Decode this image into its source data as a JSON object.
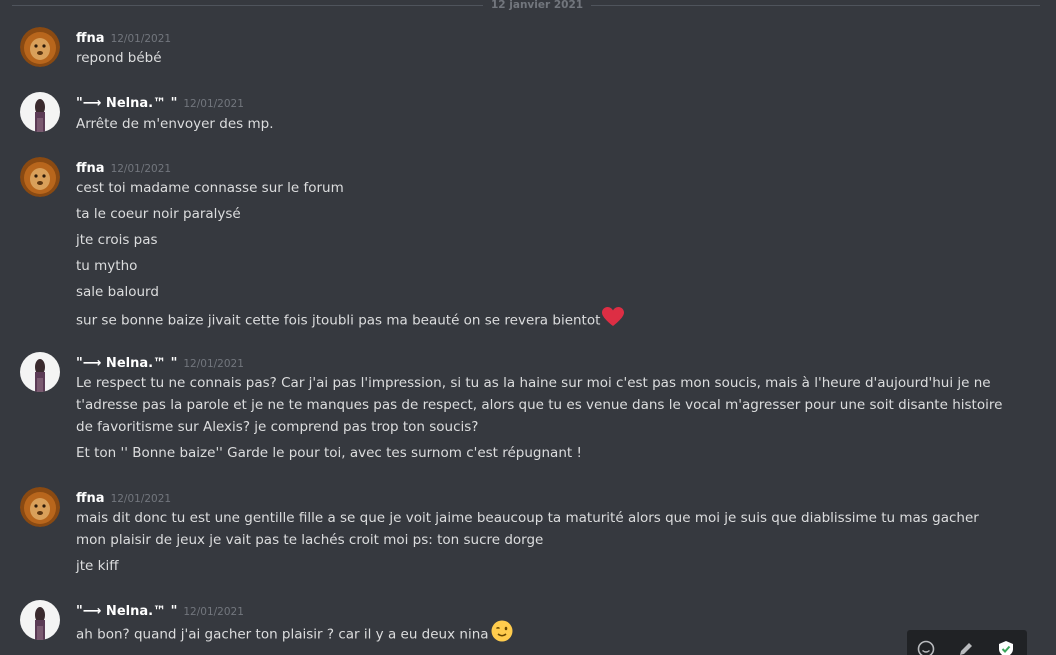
{
  "date_divider": "12 janvier 2021",
  "users": {
    "ffna": "ffna",
    "nelna": "\"⟶ Nelna.™ \""
  },
  "messages": [
    {
      "author": "ffna",
      "timestamp": "12/01/2021",
      "lines": [
        "repond bébé"
      ]
    },
    {
      "author": "\"⟶ Nelna.™ \"",
      "timestamp": "12/01/2021",
      "lines": [
        "Arrête de m'envoyer des mp."
      ]
    },
    {
      "author": "ffna",
      "timestamp": "12/01/2021",
      "lines": [
        "cest toi madame connasse sur le forum",
        "ta le coeur noir paralysé",
        "jte crois pas",
        "tu mytho",
        "sale balourd",
        "sur se bonne baize jivait cette fois jtoubli pas ma beauté on se revera bientot"
      ],
      "emoji": "red-heart"
    },
    {
      "author": "\"⟶ Nelna.™ \"",
      "timestamp": "12/01/2021",
      "lines": [
        "Le respect tu ne connais pas? Car j'ai pas l'impression, si tu as la haine sur moi c'est pas mon soucis, mais à l'heure d'aujourd'hui je ne t'adresse pas la parole et je ne te manques pas de respect, alors que tu es venue dans le vocal m'agresser pour une soit disante histoire de favoritisme sur Alexis? je comprend pas trop ton soucis?",
        "Et ton '' Bonne baize'' Garde le pour toi, avec tes surnom c'est répugnant !"
      ]
    },
    {
      "author": "ffna",
      "timestamp": "12/01/2021",
      "lines": [
        "mais dit donc tu est une gentille fille a se que je voit jaime beaucoup ta maturité alors que moi je suis que diablissime tu mas gacher mon plaisir de jeux je vait pas te lachés croit moi ps: ton sucre dorge",
        "jte kiff"
      ]
    },
    {
      "author": "\"⟶ Nelna.™ \"",
      "timestamp": "12/01/2021",
      "lines": [
        "ah bon? quand  j'ai gacher ton plaisir ? car il y a eu deux nina"
      ],
      "emoji": "winking-face"
    }
  ],
  "colors": {
    "background": "#36393f",
    "username": "#ffffff",
    "text": "#dcddde",
    "timestamp": "#72767d",
    "heart": "#dd2e44",
    "wink": "#ffcc4d"
  }
}
